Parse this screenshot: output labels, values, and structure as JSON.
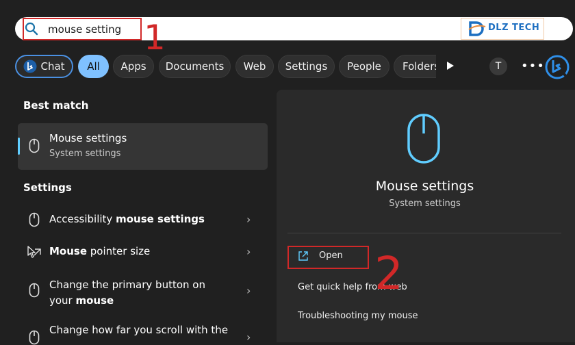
{
  "search": {
    "query": "mouse setting"
  },
  "annotations": {
    "step1": "1",
    "step2": "2"
  },
  "logo": {
    "text": "DLZ TECH"
  },
  "filters": {
    "chat": "Chat",
    "tabs": [
      "All",
      "Apps",
      "Documents",
      "Web",
      "Settings",
      "People",
      "Folders"
    ],
    "active": "All",
    "user_initial": "T",
    "more": "•••"
  },
  "best_match": {
    "heading": "Best match",
    "title": "Mouse settings",
    "subtitle": "System settings"
  },
  "settings_section": {
    "heading": "Settings",
    "items": [
      {
        "label_pre": "Accessibility ",
        "label_bold": "mouse settings",
        "label_post": "",
        "line2": ""
      },
      {
        "label_pre": "",
        "label_bold": "Mouse",
        "label_post": " pointer size",
        "line2": ""
      },
      {
        "label_pre": "Change the primary button on",
        "label_bold": "",
        "label_post": "",
        "line2_pre": "your ",
        "line2_bold": "mouse"
      },
      {
        "label_pre": "Change how far you scroll with the",
        "label_bold": "",
        "label_post": "",
        "line2": ""
      }
    ]
  },
  "details": {
    "title": "Mouse settings",
    "subtitle": "System settings",
    "actions": [
      "Open",
      "Get quick help from web",
      "Troubleshooting my mouse"
    ]
  },
  "colors": {
    "accent": "#60cdff",
    "annotation": "#d12828",
    "chip_active": "#7fc1ff",
    "background": "#202020"
  }
}
